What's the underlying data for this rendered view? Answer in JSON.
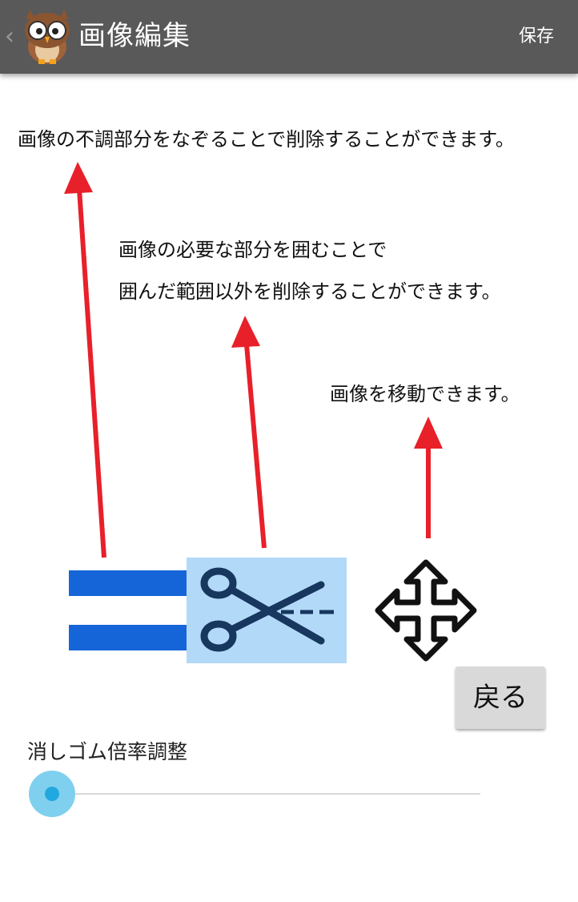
{
  "appbar": {
    "title": "画像編集",
    "save_label": "保存",
    "background": "#595959"
  },
  "instructions": {
    "eraser": "画像の不調部分をなぞることで削除することができます。",
    "crop_line1": "画像の必要な部分を囲むことで",
    "crop_line2": "囲んだ範囲以外を削除することができます。",
    "move": "画像を移動できます。"
  },
  "tools": [
    {
      "name": "eraser-tool",
      "icon": "eraser-icon"
    },
    {
      "name": "scissors-tool",
      "icon": "scissors-icon",
      "selected": true
    },
    {
      "name": "move-tool",
      "icon": "move-arrows-icon"
    }
  ],
  "back_label": "戻る",
  "slider": {
    "label": "消しゴム倍率調整",
    "value": 0,
    "accent": "#22a8e0"
  },
  "arrow_color": "#e8202a"
}
